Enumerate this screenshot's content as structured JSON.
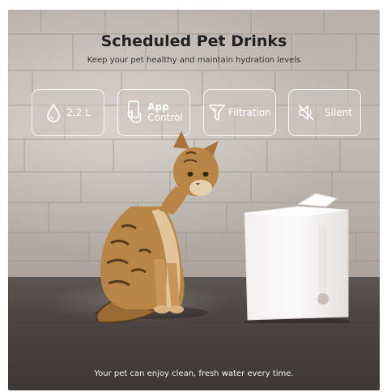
{
  "header": {
    "title": "Scheduled Pet Drinks",
    "subtitle": "Keep your pet healthy and maintain hydration levels"
  },
  "features": {
    "capacity": {
      "label": "2.2 L",
      "icon": "water-drop-icon"
    },
    "app": {
      "label_bold": "App",
      "label_regular": "Control",
      "icon": "phone-tap-icon"
    },
    "filtration": {
      "label": "Filtration",
      "icon": "funnel-icon"
    },
    "silent": {
      "label": "Silent",
      "icon": "speaker-muted-icon"
    }
  },
  "footer": {
    "caption": "Your pet can enjoy clean, fresh water every time."
  },
  "colors": {
    "title": "#222222",
    "badge_border": "#ffffff",
    "badge_fill": "#cdc6c0"
  }
}
